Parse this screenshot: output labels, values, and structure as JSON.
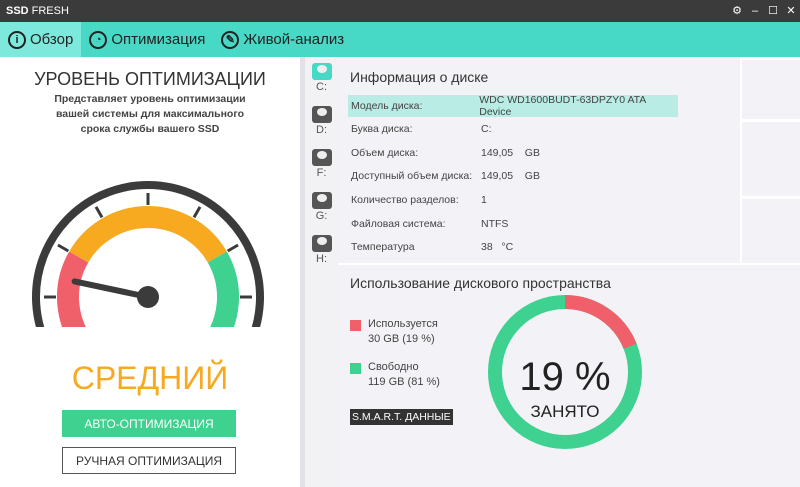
{
  "window": {
    "title_bold": "SSD",
    "title_rest": "FRESH",
    "controls": [
      "⚙",
      "–",
      "☐",
      "✕"
    ]
  },
  "tabs": [
    {
      "label": "Обзор",
      "icon": "i"
    },
    {
      "label": "Оптимизация",
      "icon": "◔"
    },
    {
      "label": "Живой-анализ",
      "icon": "✎"
    }
  ],
  "left": {
    "title": "УРОВЕНЬ ОПТИМИЗАЦИИ",
    "desc": [
      "Представляет уровень оптимизации",
      "вашей системы для максимального",
      "срока службы вашего SSD"
    ],
    "level": "СРЕДНИЙ",
    "gauge_value": 0.2,
    "auto_button": "АВТО-ОПТИМИЗАЦИЯ",
    "manual_button": "РУЧНАЯ ОПТИМИЗАЦИЯ"
  },
  "drives": [
    "C:",
    "D:",
    "F:",
    "G:",
    "H:"
  ],
  "info": {
    "title": "Информация о диске",
    "rows": [
      {
        "k": "Модель диска:",
        "v": "WDC WD1600BUDT-63DPZY0 ATA Device"
      },
      {
        "k": "Буква диска:",
        "v": "C:"
      },
      {
        "k": "Объем диска:",
        "v": "149,05    GB"
      },
      {
        "k": "Доступный объем диска:",
        "v": "149,05    GB"
      },
      {
        "k": "Количество разделов:",
        "v": "1"
      },
      {
        "k": "Файловая система:",
        "v": "NTFS"
      },
      {
        "k": "Температура",
        "v": "38   °C"
      }
    ]
  },
  "usage": {
    "title": "Использование дискового пространства",
    "used_label": "Используется",
    "used_value": "30 GB (19 %)",
    "free_label": "Свободно",
    "free_value": "119 GB (81 %)",
    "smart_button": "S.M.A.R.T. ДАННЫЕ",
    "percent": "19 %",
    "percent_value": 19,
    "caption": "ЗАНЯТО",
    "colors": {
      "used": "#f0606a",
      "free": "#3ed18f"
    }
  }
}
